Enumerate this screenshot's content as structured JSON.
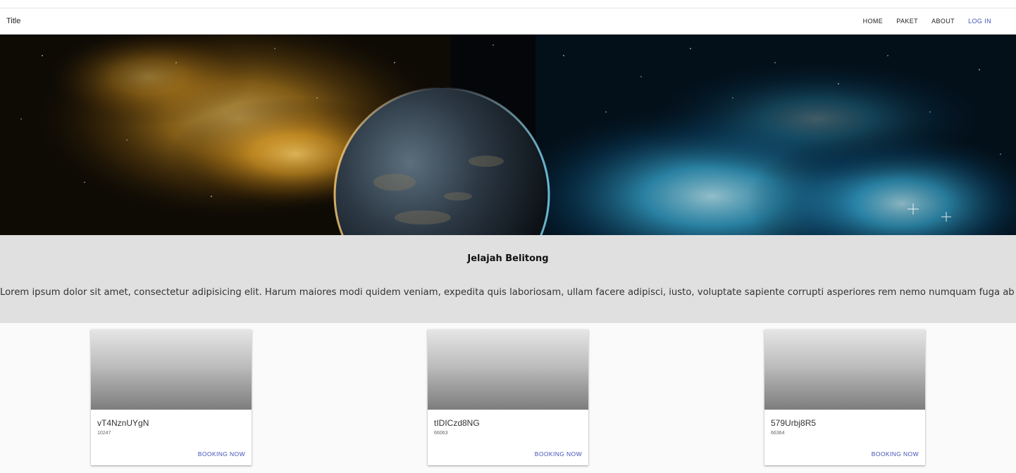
{
  "navbar": {
    "title": "Title",
    "items": [
      {
        "label": "HOME"
      },
      {
        "label": "PAKET"
      },
      {
        "label": "ABOUT"
      },
      {
        "label": "LOG IN"
      }
    ]
  },
  "info": {
    "heading": "Jelajah Belitong",
    "text": "Lorem ipsum dolor sit amet, consectetur adipisicing elit. Harum maiores modi quidem veniam, expedita quis laboriosam, ullam facere adipisci, iusto, voluptate sapiente corrupti asperiores rem nemo numquam fuga ab at."
  },
  "cards": [
    {
      "title": "vT4NznUYgN",
      "subtitle": "10247",
      "action": "BOOKING NOW"
    },
    {
      "title": "tIDICzd8NG",
      "subtitle": "66063",
      "action": "BOOKING NOW"
    },
    {
      "title": "579Urbj8R5",
      "subtitle": "66364",
      "action": "BOOKING NOW"
    }
  ],
  "colors": {
    "accent": "#3f51b5",
    "info_background": "#e0e0e0"
  }
}
